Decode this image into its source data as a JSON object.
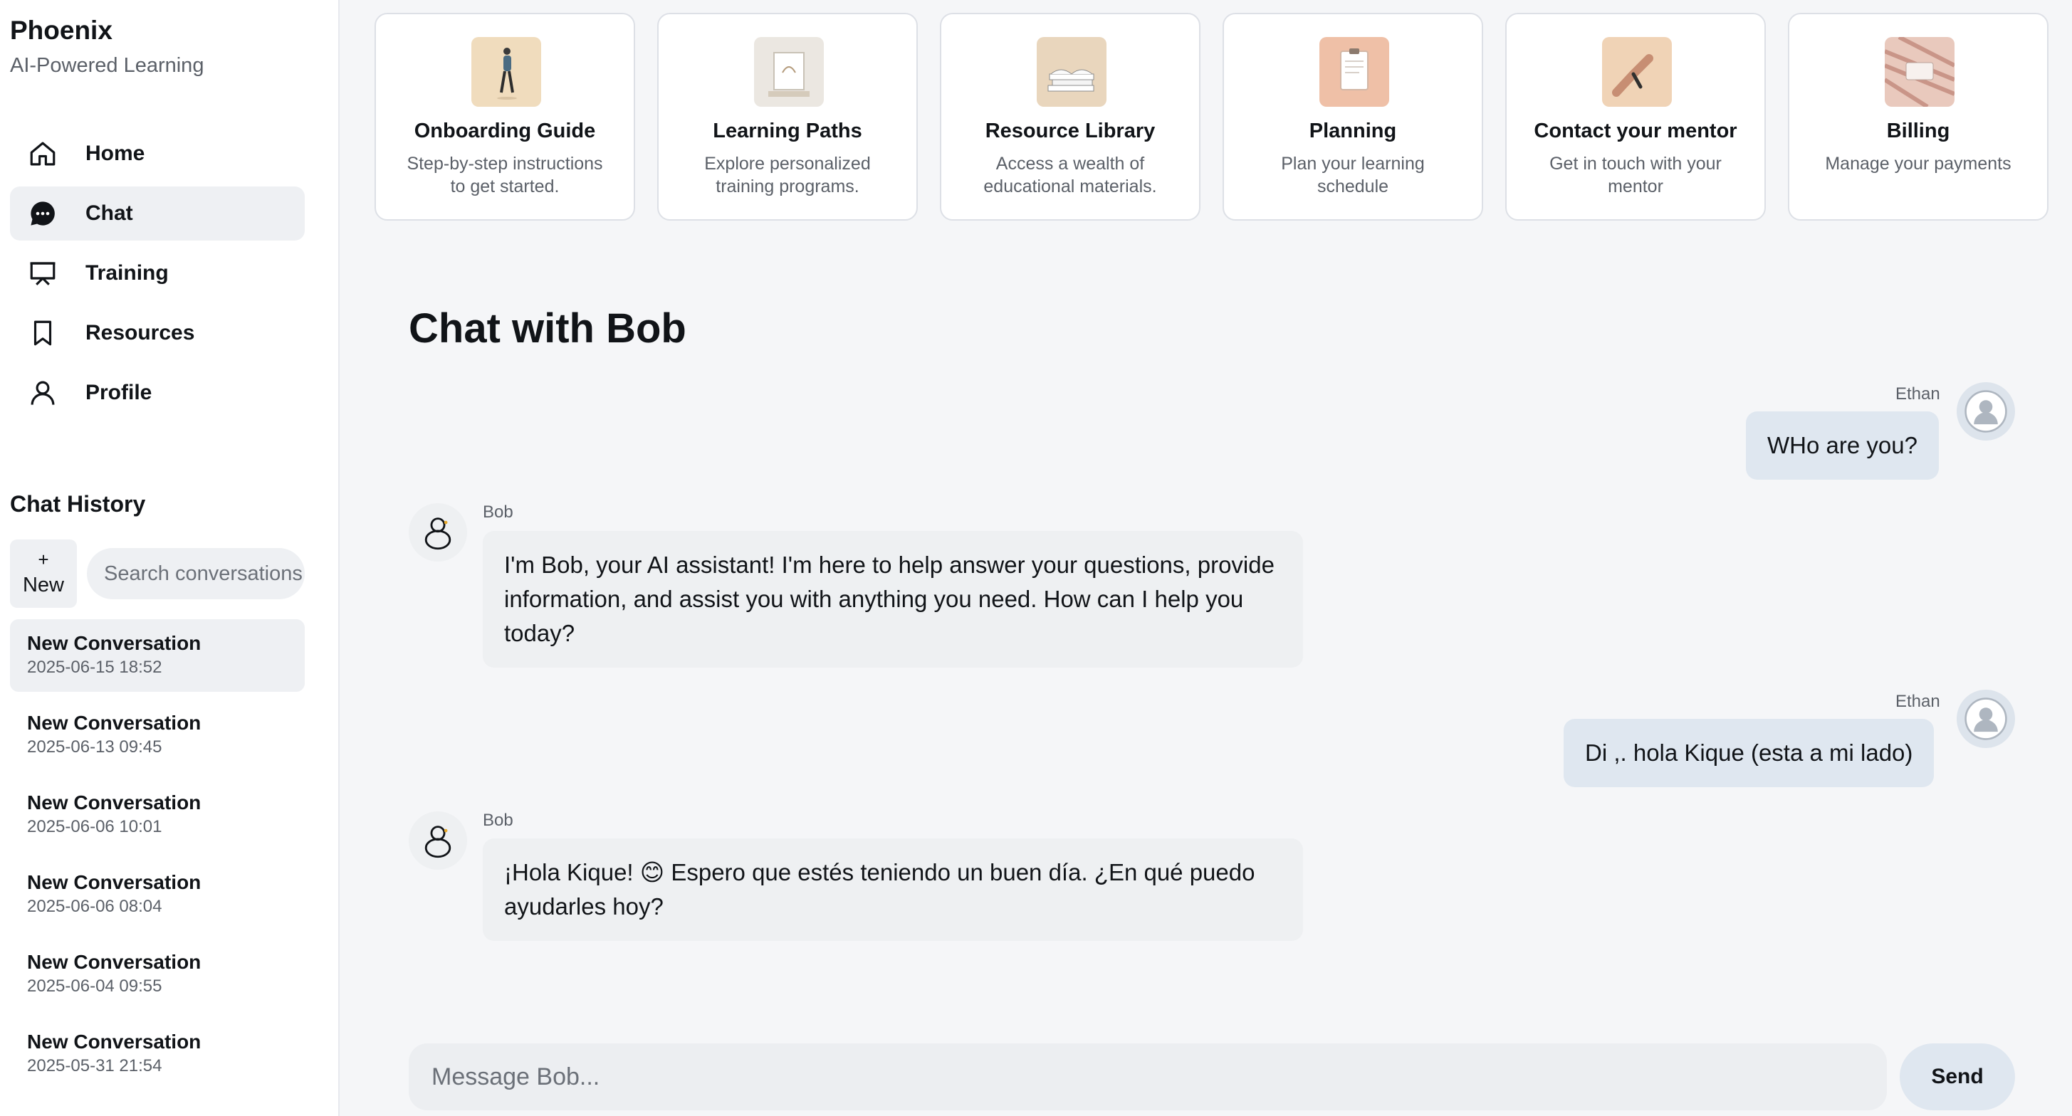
{
  "brand": {
    "title": "Phoenix",
    "subtitle": "AI-Powered Learning"
  },
  "nav": {
    "items": [
      {
        "label": "Home",
        "icon": "home-icon"
      },
      {
        "label": "Chat",
        "icon": "chat-bubble-icon",
        "active": true
      },
      {
        "label": "Training",
        "icon": "presentation-icon"
      },
      {
        "label": "Resources",
        "icon": "bookmark-icon"
      },
      {
        "label": "Profile",
        "icon": "user-icon"
      }
    ]
  },
  "history": {
    "title": "Chat History",
    "new_plus": "+",
    "new_label": "New",
    "search_placeholder": "Search conversations",
    "conversations": [
      {
        "name": "New Conversation",
        "date": "2025-06-15 18:52",
        "active": true
      },
      {
        "name": "New Conversation",
        "date": "2025-06-13 09:45"
      },
      {
        "name": "New Conversation",
        "date": "2025-06-06 10:01"
      },
      {
        "name": "New Conversation",
        "date": "2025-06-06 08:04"
      },
      {
        "name": "New Conversation",
        "date": "2025-06-04 09:55"
      },
      {
        "name": "New Conversation",
        "date": "2025-05-31 21:54"
      }
    ]
  },
  "cards": [
    {
      "title": "Onboarding Guide",
      "desc": "Step-by-step instructions to get started.",
      "image": "walking-person-illustration"
    },
    {
      "title": "Learning Paths",
      "desc": "Explore personalized training programs.",
      "image": "framed-print-illustration"
    },
    {
      "title": "Resource Library",
      "desc": "Access a wealth of educational materials.",
      "image": "book-stack-illustration"
    },
    {
      "title": "Planning",
      "desc": "Plan your learning schedule",
      "image": "clipboard-illustration"
    },
    {
      "title": "Contact your mentor",
      "desc": "Get in touch with your mentor",
      "image": "hand-gesture-illustration"
    },
    {
      "title": "Billing",
      "desc": "Manage your payments",
      "image": "credit-card-illustration"
    }
  ],
  "chat": {
    "title": "Chat with Bob",
    "messages": [
      {
        "sender": "Ethan",
        "role": "user",
        "text": "WHo are you?"
      },
      {
        "sender": "Bob",
        "role": "bot",
        "text": "I'm Bob, your AI assistant! I'm here to help answer your questions, provide information, and assist you with anything you need. How can I help you today?"
      },
      {
        "sender": "Ethan",
        "role": "user",
        "text": "Di ,. hola Kique (esta a mi lado)"
      },
      {
        "sender": "Bob",
        "role": "bot",
        "text": "¡Hola Kique! 😊 Espero que estés teniendo un buen día. ¿En qué puedo ayudarles hoy?"
      }
    ]
  },
  "composer": {
    "placeholder": "Message Bob...",
    "send_label": "Send"
  },
  "colors": {
    "user_bubble": "#dfe7f0",
    "bot_bubble": "#eef0f2",
    "active_item": "#eef0f3"
  }
}
